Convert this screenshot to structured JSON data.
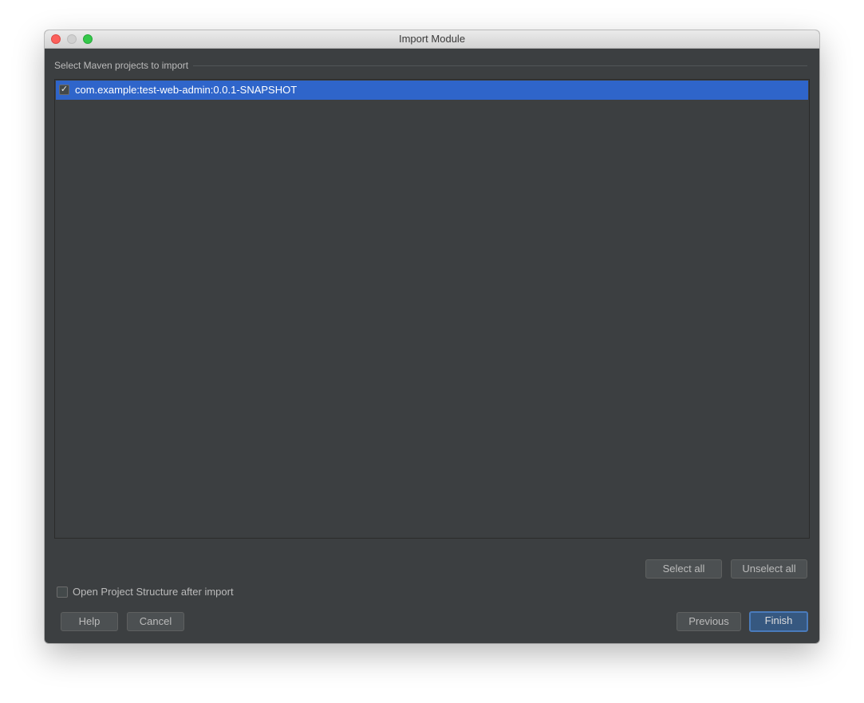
{
  "window": {
    "title": "Import Module"
  },
  "section": {
    "label": "Select Maven projects to import"
  },
  "projects": [
    {
      "label": "com.example:test-web-admin:0.0.1-SNAPSHOT",
      "checked": true,
      "check_glyph": "✓"
    }
  ],
  "buttons": {
    "select_all": "Select all",
    "unselect_all": "Unselect all",
    "help": "Help",
    "cancel": "Cancel",
    "previous": "Previous",
    "finish": "Finish"
  },
  "options": {
    "open_structure_label": "Open Project Structure after import",
    "open_structure_checked": false
  },
  "colors": {
    "selection": "#2f65ca",
    "dialog_bg": "#3c3f41",
    "default_button": "#365880"
  }
}
